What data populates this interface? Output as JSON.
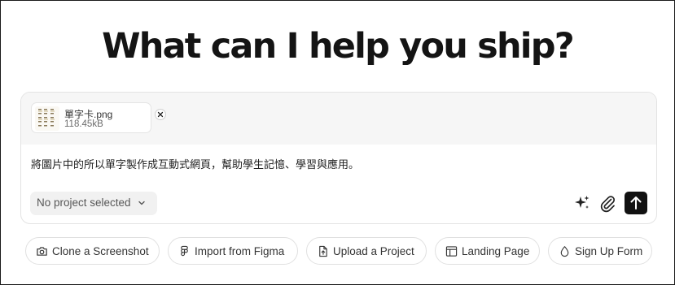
{
  "heading": "What can I help you ship?",
  "attachment": {
    "file_name": "單字卡.png",
    "file_size": "118.45kB",
    "icon": "image-thumbnail"
  },
  "prompt": {
    "text": "將圖片中的所以單字製作成互動式網頁，幫助學生記憶、學習與應用。"
  },
  "project_selector": {
    "label": "No project selected",
    "icon": "chevron-down-icon"
  },
  "actions": {
    "enhance_icon": "sparkles-icon",
    "attach_icon": "paperclip-icon",
    "send_icon": "arrow-up-icon"
  },
  "suggestions": [
    {
      "label": "Clone a Screenshot",
      "icon": "camera-icon"
    },
    {
      "label": "Import from Figma",
      "icon": "figma-icon"
    },
    {
      "label": "Upload a Project",
      "icon": "file-upload-icon"
    },
    {
      "label": "Landing Page",
      "icon": "layout-icon"
    },
    {
      "label": "Sign Up Form",
      "icon": "droplet-icon"
    }
  ],
  "colors": {
    "send_button": "#111111",
    "text": "#171717",
    "muted": "#6b6b6b",
    "attach_strip": "#f6f6f6"
  }
}
